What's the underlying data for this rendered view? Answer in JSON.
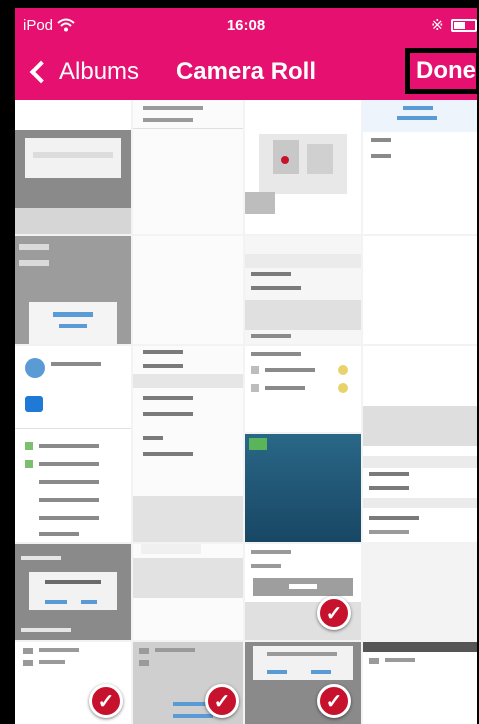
{
  "status_bar": {
    "carrier": "iPod",
    "wifi_icon": "wifi-icon",
    "time": "16:08",
    "bluetooth_icon": "bluetooth-icon",
    "battery_level": 0.55
  },
  "nav": {
    "back_label": "Albums",
    "title": "Camera Roll",
    "done_label": "Done"
  },
  "colors": {
    "accent": "#e5106f",
    "check": "#c7122d"
  },
  "photos": [
    {
      "id": 1,
      "selected": false
    },
    {
      "id": 2,
      "selected": false
    },
    {
      "id": 3,
      "selected": false
    },
    {
      "id": 4,
      "selected": false
    },
    {
      "id": 5,
      "selected": false
    },
    {
      "id": 6,
      "selected": false
    },
    {
      "id": 7,
      "selected": false
    },
    {
      "id": 8,
      "selected": false
    },
    {
      "id": 9,
      "selected": false
    },
    {
      "id": 10,
      "selected": false
    },
    {
      "id": 11,
      "selected": false
    },
    {
      "id": 12,
      "selected": false
    },
    {
      "id": 13,
      "selected": false
    },
    {
      "id": 14,
      "selected": true
    },
    {
      "id": 15,
      "selected": false
    },
    {
      "id": 16,
      "selected": true
    },
    {
      "id": 17,
      "selected": true
    },
    {
      "id": 18,
      "selected": true
    },
    {
      "id": 19,
      "selected": false
    }
  ]
}
